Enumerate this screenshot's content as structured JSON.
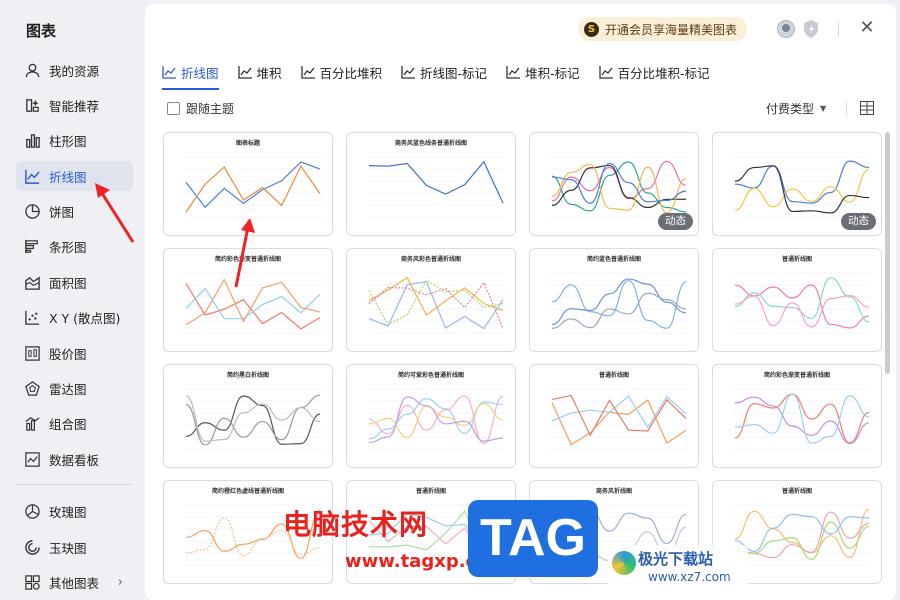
{
  "sidebar": {
    "title": "图表",
    "items": [
      {
        "label": "我的资源",
        "icon": "user-icon"
      },
      {
        "label": "智能推荐",
        "icon": "sparkle-icon"
      },
      {
        "label": "柱形图",
        "icon": "bar-chart-icon"
      },
      {
        "label": "折线图",
        "icon": "line-chart-icon",
        "active": true
      },
      {
        "label": "饼图",
        "icon": "pie-chart-icon"
      },
      {
        "label": "条形图",
        "icon": "horizontal-bar-icon"
      },
      {
        "label": "面积图",
        "icon": "area-chart-icon"
      },
      {
        "label": "X Y (散点图)",
        "icon": "scatter-icon"
      },
      {
        "label": "股价图",
        "icon": "stock-chart-icon"
      },
      {
        "label": "雷达图",
        "icon": "radar-chart-icon"
      },
      {
        "label": "组合图",
        "icon": "combo-chart-icon"
      },
      {
        "label": "数据看板",
        "icon": "dashboard-icon"
      },
      {
        "label": "玫瑰图",
        "icon": "rose-chart-icon"
      },
      {
        "label": "玉玦图",
        "icon": "ring-chart-icon"
      },
      {
        "label": "其他图表",
        "icon": "other-chart-icon"
      }
    ]
  },
  "header": {
    "vip_label": "开通会员享海量精美图表",
    "close_icon": "close-icon"
  },
  "tabs": [
    {
      "label": "折线图",
      "active": true
    },
    {
      "label": "堆积"
    },
    {
      "label": "百分比堆积"
    },
    {
      "label": "折线图-标记"
    },
    {
      "label": "堆积-标记"
    },
    {
      "label": "百分比堆积-标记"
    }
  ],
  "toolbar": {
    "follow_theme": "跟随主题",
    "pay_type": "付费类型"
  },
  "cards": [
    {
      "title": "图表标题",
      "badge": ""
    },
    {
      "title": "商务风蓝色线条普通折线图",
      "badge": ""
    },
    {
      "title": "",
      "badge": "动态"
    },
    {
      "title": "",
      "badge": "动态"
    },
    {
      "title": "简约彩色渐变普通折线图",
      "badge": ""
    },
    {
      "title": "商务风彩色普通折线图",
      "badge": ""
    },
    {
      "title": "简约蓝色普通折线图",
      "badge": ""
    },
    {
      "title": "普通折线图",
      "badge": ""
    },
    {
      "title": "简约黑白折线图",
      "badge": ""
    },
    {
      "title": "简约可爱彩色普通折线图",
      "badge": ""
    },
    {
      "title": "普通折线图",
      "badge": ""
    },
    {
      "title": "简约彩色渐变普通折线图",
      "badge": ""
    },
    {
      "title": "简约橙红色虚线普通折线图",
      "badge": ""
    },
    {
      "title": "普通折线图",
      "badge": ""
    },
    {
      "title": "商务风折线图",
      "badge": ""
    },
    {
      "title": "普通折线图",
      "badge": ""
    }
  ],
  "watermark": {
    "site_name": "电脑技术网",
    "site_url": "www.tagxp.com",
    "tag": "TAG",
    "partner": "极光下载站",
    "partner_url": "www.xz7.com"
  }
}
